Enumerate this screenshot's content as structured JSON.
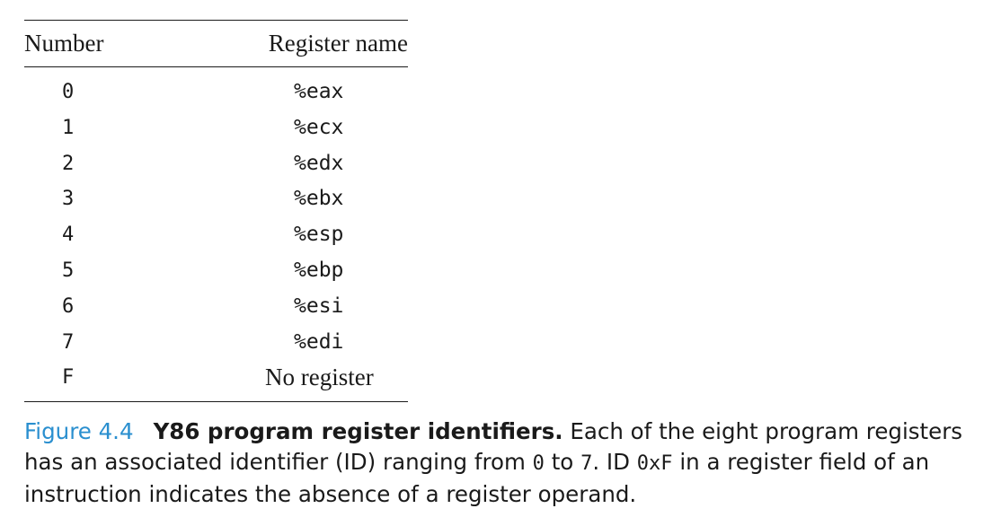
{
  "table": {
    "headers": {
      "number": "Number",
      "register_name": "Register name"
    },
    "rows": [
      {
        "number": "0",
        "name": "%eax",
        "font": "mono"
      },
      {
        "number": "1",
        "name": "%ecx",
        "font": "mono"
      },
      {
        "number": "2",
        "name": "%edx",
        "font": "mono"
      },
      {
        "number": "3",
        "name": "%ebx",
        "font": "mono"
      },
      {
        "number": "4",
        "name": "%esp",
        "font": "mono"
      },
      {
        "number": "5",
        "name": "%ebp",
        "font": "mono"
      },
      {
        "number": "6",
        "name": "%esi",
        "font": "mono"
      },
      {
        "number": "7",
        "name": "%edi",
        "font": "mono"
      },
      {
        "number": "F",
        "name": "No register",
        "font": "serif"
      }
    ]
  },
  "caption": {
    "label": "Figure 4.4",
    "title": "Y86 program register identifiers.",
    "text_1": " Each of the eight program registers has an associated identifier (ID) ranging from ",
    "code_1": "0",
    "text_2": " to ",
    "code_2": "7",
    "text_3": ". ID ",
    "code_3": "0xF",
    "text_4": " in a register field of an instruction indicates the absence of a register operand.",
    "label_color": "#2a8fcf"
  }
}
